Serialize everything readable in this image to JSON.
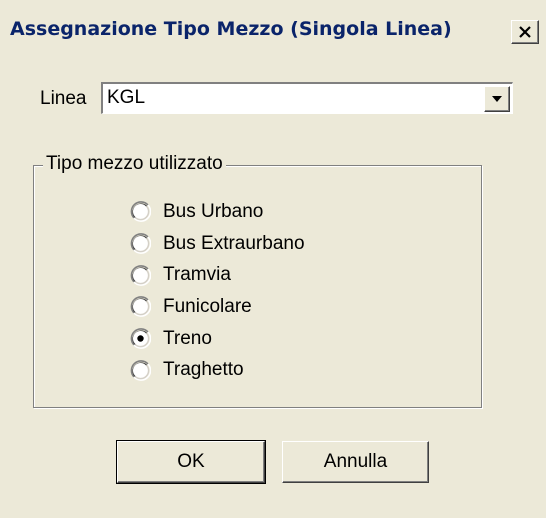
{
  "window": {
    "title": "Assegnazione Tipo Mezzo (Singola Linea)",
    "close_icon": "close-icon"
  },
  "linea": {
    "label": "Linea",
    "value": "KGL",
    "dropdown_icon": "chevron-down-icon"
  },
  "group": {
    "legend": "Tipo mezzo utilizzato",
    "options": [
      {
        "label": "Bus Urbano",
        "selected": false
      },
      {
        "label": "Bus Extraurbano",
        "selected": false
      },
      {
        "label": "Tramvia",
        "selected": false
      },
      {
        "label": "Funicolare",
        "selected": false
      },
      {
        "label": "Treno",
        "selected": true
      },
      {
        "label": "Traghetto",
        "selected": false
      }
    ]
  },
  "buttons": {
    "ok_label": "OK",
    "cancel_label": "Annulla"
  }
}
